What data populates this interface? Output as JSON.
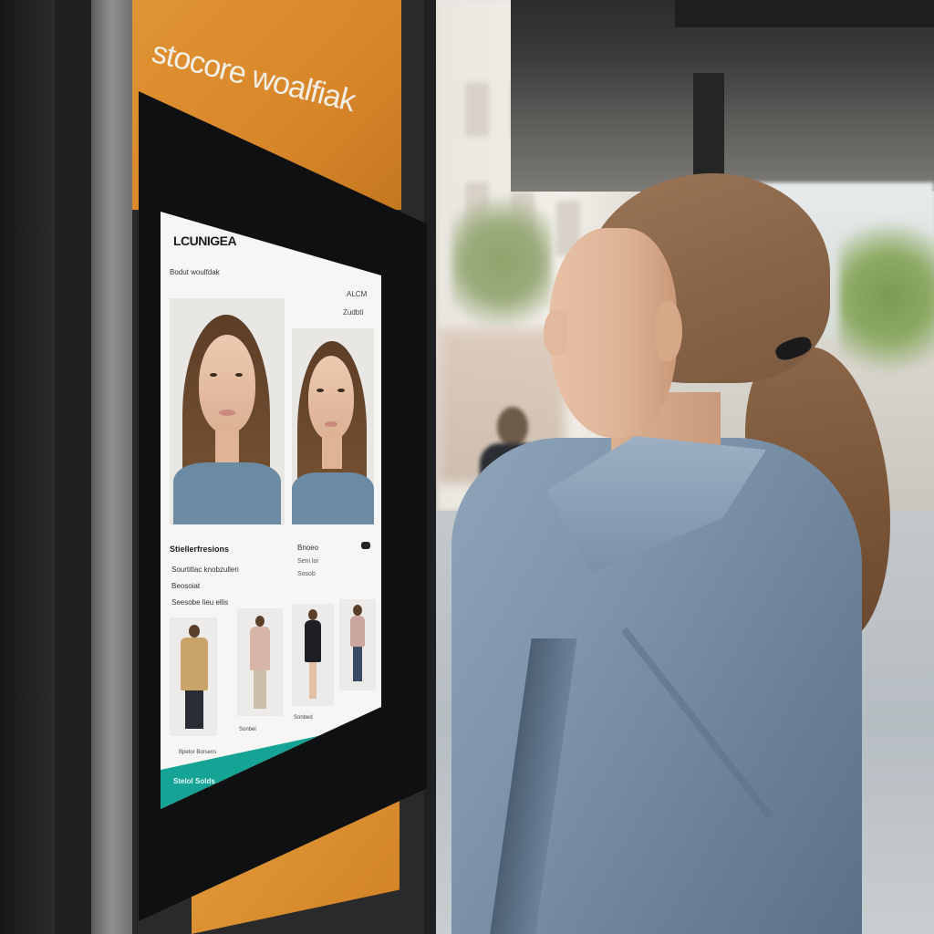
{
  "scene": {
    "description_free": true
  },
  "kiosk": {
    "brand_text": "stocore woalfiak"
  },
  "display": {
    "logo": "LCUNIGEA",
    "subtitle": "Bodut woulfdak",
    "code_1": "ALCM",
    "code_2": "Zudbti",
    "info_title": "Stiellerfresions",
    "info_line_1": "Sourtitlac knobzulleri",
    "info_line_2": "Beosoiat",
    "info_line_3": "Seesobe lieu ellis",
    "col2_title": "Bnoeo",
    "col2_line_1": "Seni loi",
    "col2_line_2": "Sosob",
    "caption_1": "Bpetor Borsens",
    "caption_2": "Sonbel",
    "caption_3": "Sonbed",
    "footer": "Stelol Solds",
    "accent_color": "#14a394"
  }
}
